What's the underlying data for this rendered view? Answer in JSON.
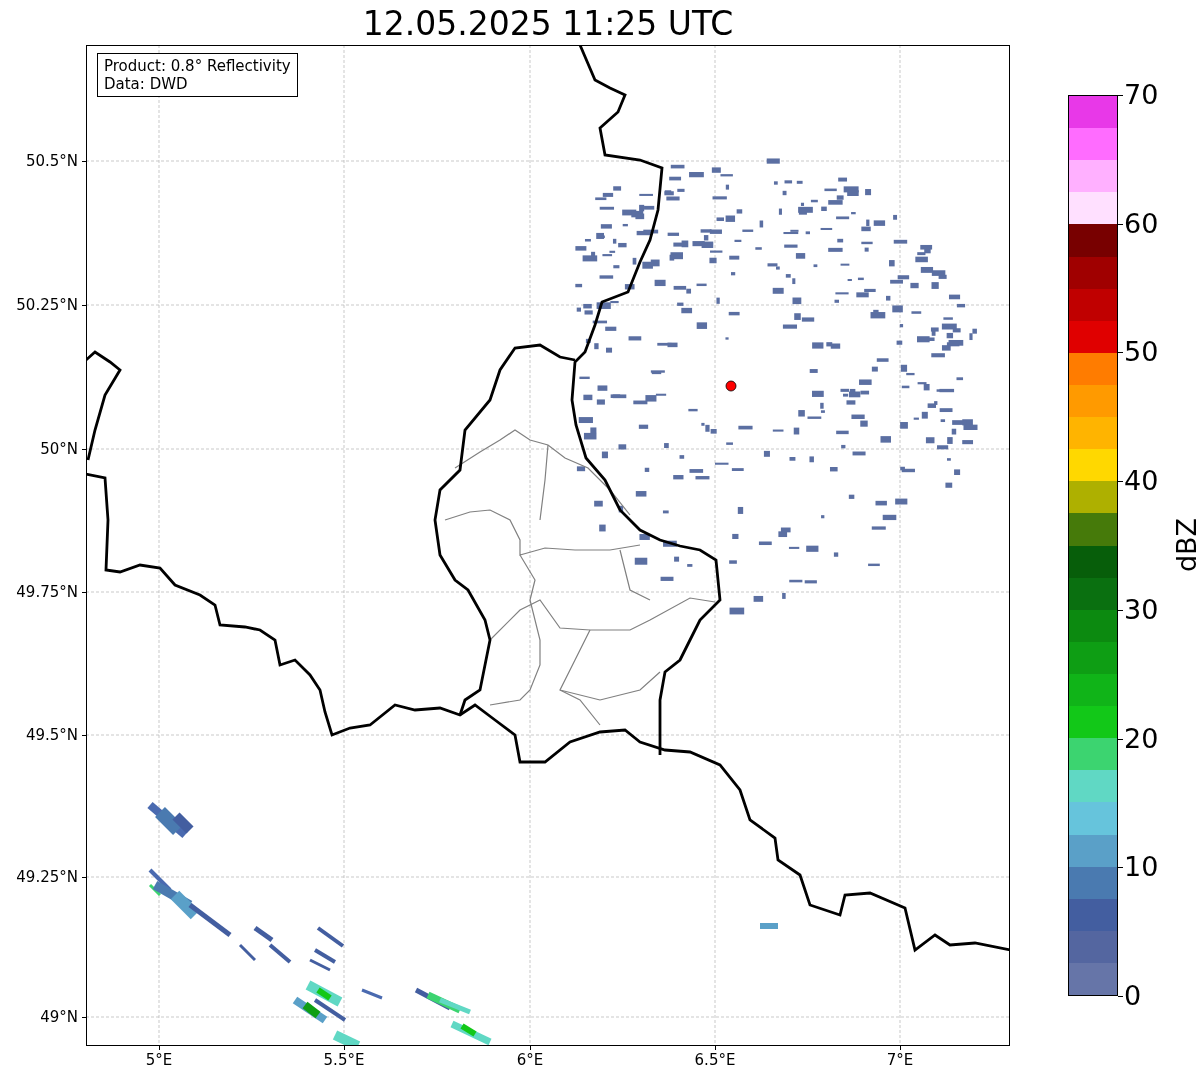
{
  "title": "12.05.2025 11:25 UTC",
  "info_box": [
    "Product: 0.8° Reflectivity",
    "Data: DWD"
  ],
  "map": {
    "lat_ticks": [
      "50.5°N",
      "50.25°N",
      "50°N",
      "49.75°N",
      "49.5°N",
      "49.25°N",
      "49°N"
    ],
    "lon_ticks": [
      "5°E",
      "5.5°E",
      "6°E",
      "6.5°E",
      "7°E"
    ]
  },
  "colorbar": {
    "label": "dBZ",
    "ticks": [
      "70",
      "60",
      "50",
      "40",
      "30",
      "20",
      "10",
      "0"
    ],
    "segments": [
      {
        "color": "#e838e8"
      },
      {
        "color": "#ff6cff"
      },
      {
        "color": "#ffb0ff"
      },
      {
        "color": "#ffe0ff"
      },
      {
        "color": "#780000"
      },
      {
        "color": "#a00000"
      },
      {
        "color": "#c00000"
      },
      {
        "color": "#e00000"
      },
      {
        "color": "#ff7c00"
      },
      {
        "color": "#ff9a00"
      },
      {
        "color": "#ffb400"
      },
      {
        "color": "#ffd800"
      },
      {
        "color": "#aeb000"
      },
      {
        "color": "#467a0a"
      },
      {
        "color": "#075e0a"
      },
      {
        "color": "#0a7010"
      },
      {
        "color": "#0c8a10"
      },
      {
        "color": "#0e9e14"
      },
      {
        "color": "#10b418"
      },
      {
        "color": "#12c818"
      },
      {
        "color": "#3cd470"
      },
      {
        "color": "#60d8c4"
      },
      {
        "color": "#66c4dc"
      },
      {
        "color": "#5aa0c8"
      },
      {
        "color": "#4a7ab0"
      },
      {
        "color": "#435ea0"
      },
      {
        "color": "#5466a0"
      },
      {
        "color": "#6675a8"
      }
    ]
  }
}
